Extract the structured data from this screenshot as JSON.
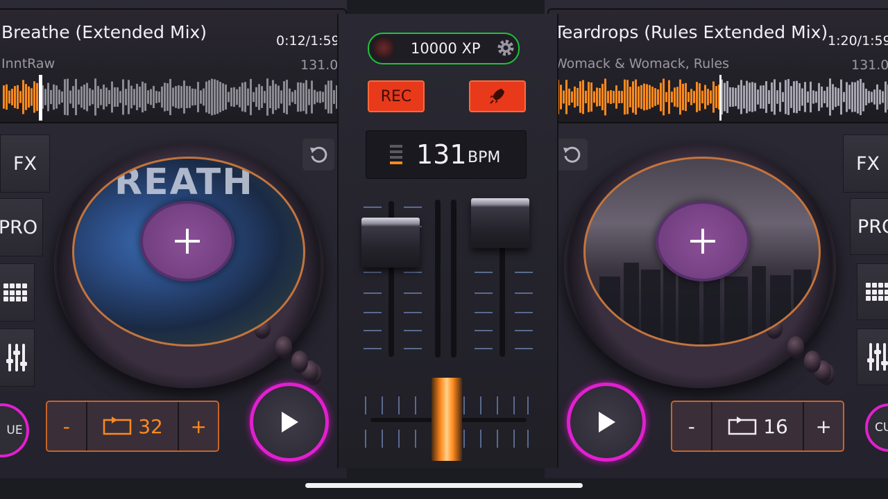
{
  "deckA": {
    "title": "Breathe (Extended Mix)",
    "artist": "InntRaw",
    "time": "0:12/1:59",
    "bpm": "131.0",
    "art_text": "REATH",
    "side_buttons": [
      "FX",
      "PRO"
    ],
    "loop_minus": "-",
    "loop_value": "32",
    "loop_plus": "+",
    "cue_label": "UE"
  },
  "deckB": {
    "title": "Teardrops (Rules Extended Mix)",
    "artist": "Womack & Womack, Rules",
    "time": "1:20/1:59",
    "bpm": "131.0",
    "side_buttons": [
      "FX",
      "PRO"
    ],
    "loop_minus": "-",
    "loop_value": "16",
    "loop_plus": "+",
    "cue_label": "CU"
  },
  "mixer": {
    "xp": "10000 XP",
    "rec_label": "REC",
    "bpm_value": "131",
    "bpm_unit": "BPM"
  },
  "colors": {
    "accent_orange": "#ff8a1e",
    "accent_magenta": "#e21fd0",
    "xp_green": "#1ec43a",
    "rec_red": "#e8391b"
  },
  "icons": [
    "settings-gear-icon",
    "rocket-icon",
    "reset-icon",
    "plus-icon",
    "play-icon",
    "loop-icon",
    "grid-icon",
    "equalizer-icon"
  ]
}
